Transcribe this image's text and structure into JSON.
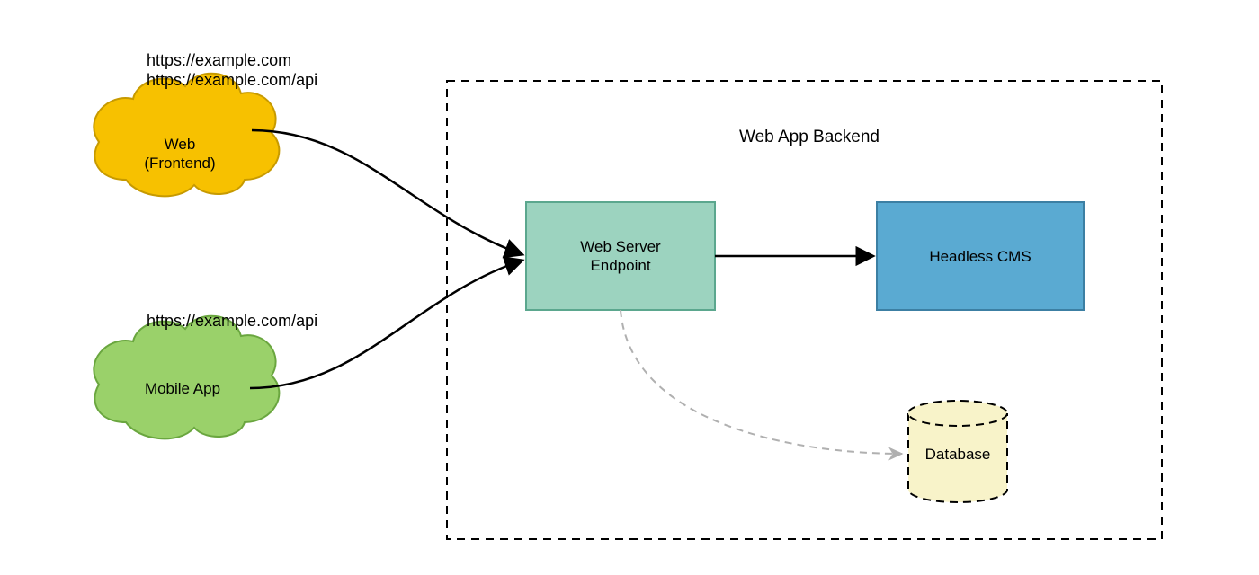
{
  "urls": {
    "web_line1": "https://example.com",
    "web_line2": "https://example.com/api",
    "mobile": "https://example.com/api"
  },
  "nodes": {
    "web_frontend": "Web\n(Frontend)",
    "mobile_app": "Mobile App",
    "web_server": "Web Server\nEndpoint",
    "headless_cms": "Headless CMS",
    "database": "Database"
  },
  "container": {
    "title": "Web App Backend"
  },
  "colors": {
    "web_cloud_fill": "#f7c100",
    "web_cloud_stroke": "#c79a00",
    "mobile_cloud_fill": "#9ad16a",
    "mobile_cloud_stroke": "#6aa63f",
    "server_fill": "#9cd3bf",
    "server_stroke": "#5ba78e",
    "cms_fill": "#5aaad2",
    "cms_stroke": "#3c7fa3",
    "db_fill": "#f8f3c9",
    "dash_gray": "#b0b0b0"
  }
}
